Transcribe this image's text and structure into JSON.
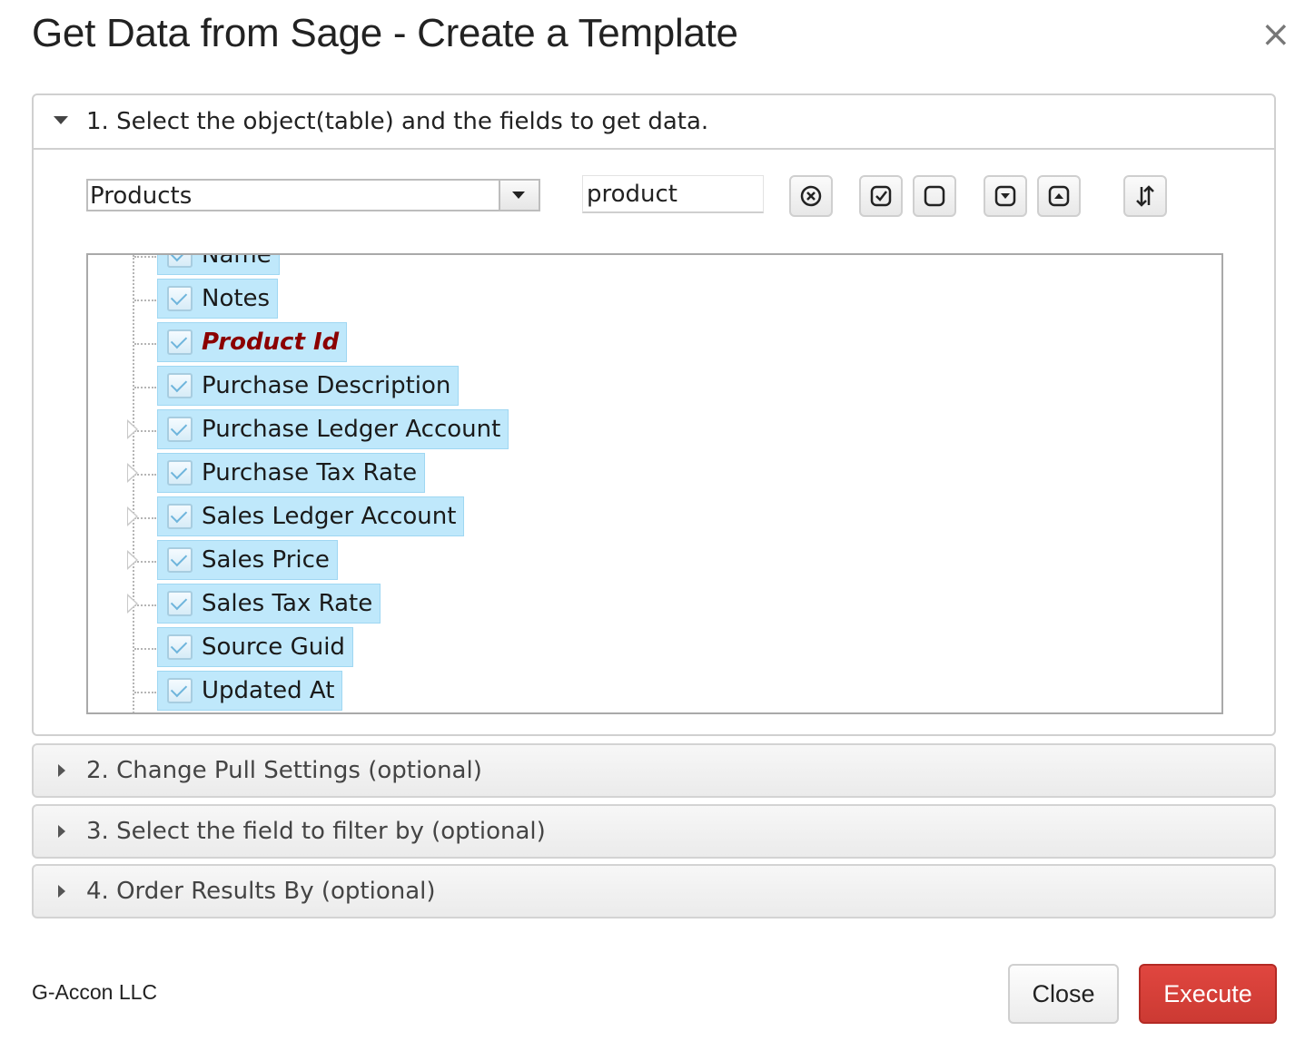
{
  "dialog": {
    "title": "Get Data from Sage - Create a Template",
    "close_icon": "close-icon"
  },
  "section1": {
    "label": "1. Select the object(table) and the fields to get data.",
    "object_select": {
      "value": "Products"
    },
    "field_search": {
      "value": "product"
    },
    "toolbar_icons": [
      "clear-search-icon",
      "check-all-icon",
      "uncheck-all-icon",
      "expand-all-icon",
      "collapse-all-icon",
      "sort-icon"
    ],
    "fields": [
      {
        "label": "Name",
        "expandable": false,
        "key": false
      },
      {
        "label": "Notes",
        "expandable": false,
        "key": false
      },
      {
        "label": "Product Id",
        "expandable": false,
        "key": true
      },
      {
        "label": "Purchase Description",
        "expandable": false,
        "key": false
      },
      {
        "label": "Purchase Ledger Account",
        "expandable": true,
        "key": false
      },
      {
        "label": "Purchase Tax Rate",
        "expandable": true,
        "key": false
      },
      {
        "label": "Sales Ledger Account",
        "expandable": true,
        "key": false
      },
      {
        "label": "Sales Price",
        "expandable": true,
        "key": false
      },
      {
        "label": "Sales Tax Rate",
        "expandable": true,
        "key": false
      },
      {
        "label": "Source Guid",
        "expandable": false,
        "key": false
      },
      {
        "label": "Updated At",
        "expandable": false,
        "key": false
      }
    ]
  },
  "section2": {
    "label": "2. Change Pull Settings (optional)"
  },
  "section3": {
    "label": "3. Select the field to filter by (optional)"
  },
  "section4": {
    "label": "4. Order Results By (optional)"
  },
  "footer": {
    "company": "G-Accon LLC",
    "close_label": "Close",
    "execute_label": "Execute"
  },
  "colors": {
    "execute": "#d9413a",
    "selected_field": "#bfe8fb",
    "key_field_text": "#8b0000"
  }
}
